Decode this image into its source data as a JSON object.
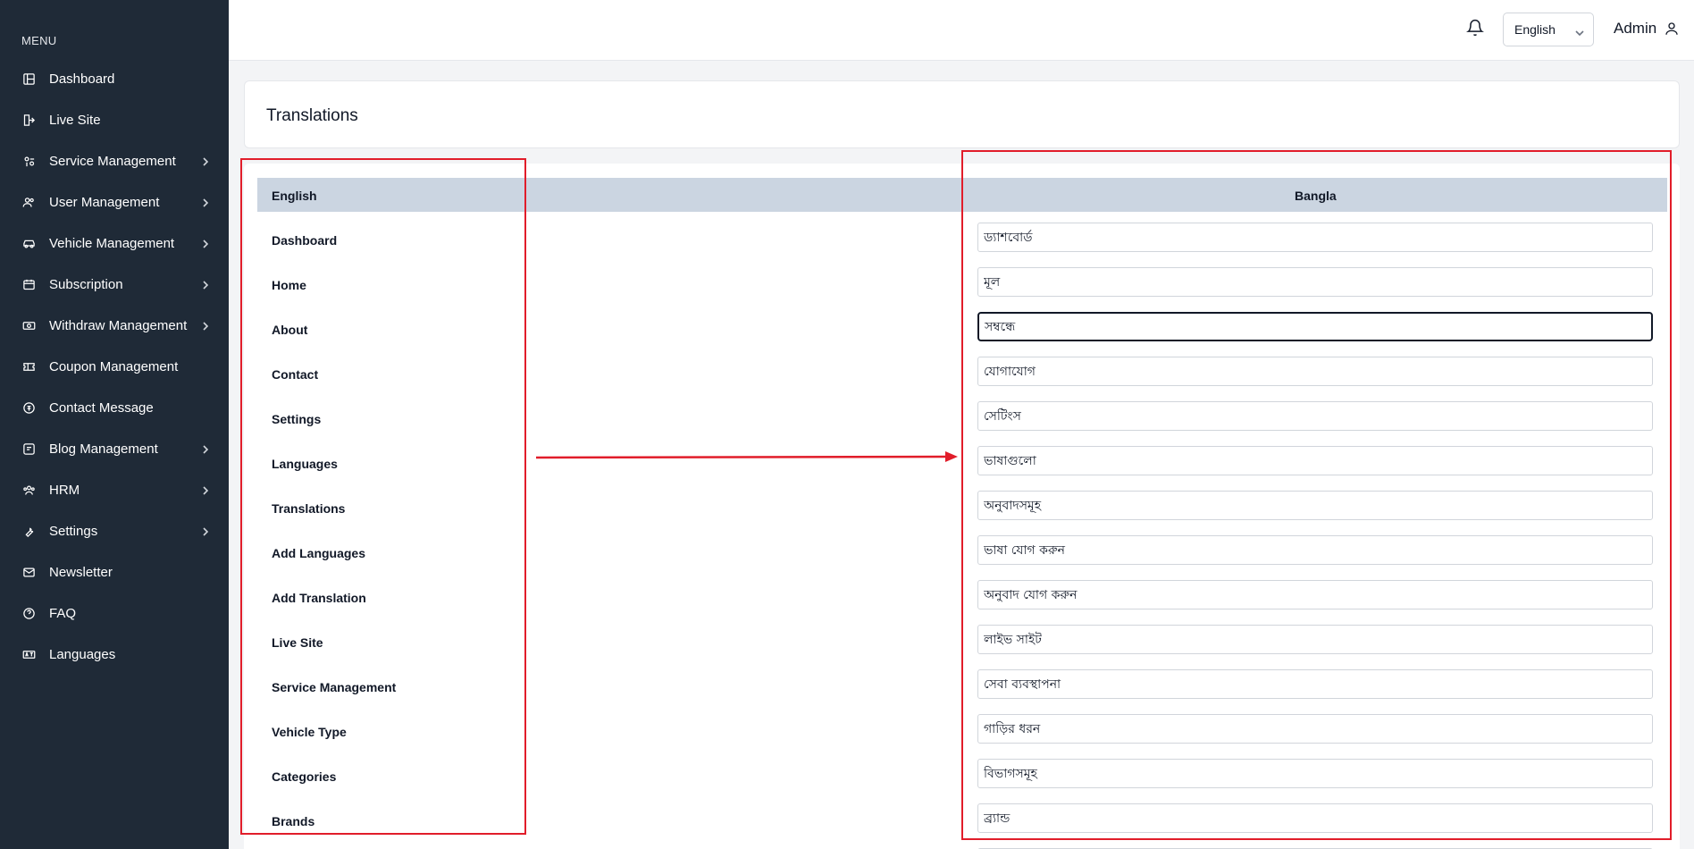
{
  "sidebar": {
    "heading": "MENU",
    "items": [
      {
        "label": "Dashboard",
        "icon": "dashboard-icon",
        "chevron": false
      },
      {
        "label": "Live Site",
        "icon": "live-site-icon",
        "chevron": false
      },
      {
        "label": "Service Management",
        "icon": "service-icon",
        "chevron": true
      },
      {
        "label": "User Management",
        "icon": "users-icon",
        "chevron": true
      },
      {
        "label": "Vehicle Management",
        "icon": "car-icon",
        "chevron": true
      },
      {
        "label": "Subscription",
        "icon": "subscription-icon",
        "chevron": true
      },
      {
        "label": "Withdraw Management",
        "icon": "withdraw-icon",
        "chevron": true
      },
      {
        "label": "Coupon Management",
        "icon": "coupon-icon",
        "chevron": false
      },
      {
        "label": "Contact Message",
        "icon": "contact-icon",
        "chevron": false
      },
      {
        "label": "Blog Management",
        "icon": "blog-icon",
        "chevron": true
      },
      {
        "label": "HRM",
        "icon": "hrm-icon",
        "chevron": true
      },
      {
        "label": "Settings",
        "icon": "wrench-icon",
        "chevron": true
      },
      {
        "label": "Newsletter",
        "icon": "mail-icon",
        "chevron": false
      },
      {
        "label": "FAQ",
        "icon": "question-icon",
        "chevron": false
      },
      {
        "label": "Languages",
        "icon": "language-icon",
        "chevron": false
      }
    ]
  },
  "topbar": {
    "language_selected": "English",
    "user_name": "Admin"
  },
  "page": {
    "title": "Translations"
  },
  "table": {
    "col_source": "English",
    "col_target": "Bangla",
    "rows": [
      {
        "key": "Dashboard",
        "value": "ড্যাশবোর্ড"
      },
      {
        "key": "Home",
        "value": "মূল"
      },
      {
        "key": "About",
        "value": "সম্বন্ধে",
        "focused": true
      },
      {
        "key": "Contact",
        "value": "যোগাযোগ"
      },
      {
        "key": "Settings",
        "value": "সেটিংস"
      },
      {
        "key": "Languages",
        "value": "ভাষাগুলো"
      },
      {
        "key": "Translations",
        "value": "অনুবাদসমূহ"
      },
      {
        "key": "Add Languages",
        "value": "ভাষা যোগ করুন"
      },
      {
        "key": "Add Translation",
        "value": "অনুবাদ যোগ করুন"
      },
      {
        "key": "Live Site",
        "value": "লাইভ সাইট"
      },
      {
        "key": "Service Management",
        "value": "সেবা ব্যবস্থাপনা"
      },
      {
        "key": "Vehicle Type",
        "value": "গাড়ির ধরন"
      },
      {
        "key": "Categories",
        "value": "বিভাগসমূহ"
      },
      {
        "key": "Brands",
        "value": "ব্র্যান্ড"
      },
      {
        "key": "",
        "value": ""
      }
    ]
  },
  "colors": {
    "sidebar_bg": "#1f2a37",
    "table_header_bg": "#cbd5e1",
    "annotation_red": "#e11d2a"
  }
}
